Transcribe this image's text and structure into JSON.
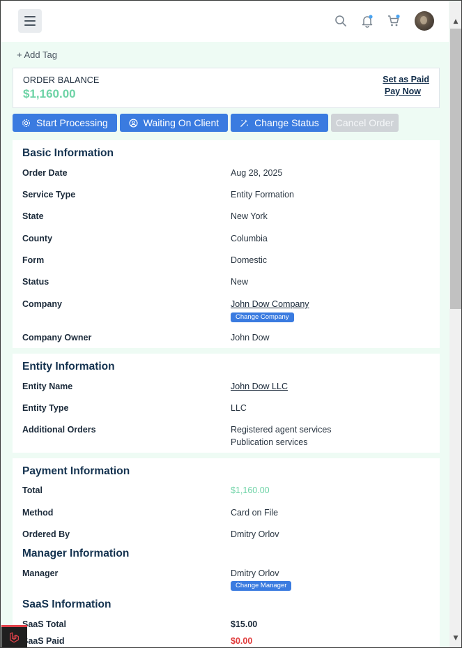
{
  "header": {
    "icons": [
      "menu-icon",
      "search-icon",
      "bell-icon",
      "cart-icon",
      "avatar"
    ],
    "accent": "#3a7be0"
  },
  "tags": {
    "add_label": "+ Add Tag"
  },
  "balance": {
    "label": "ORDER BALANCE",
    "value": "$1,160.00",
    "set_paid": "Set as Paid",
    "pay_now": "Pay Now",
    "value_color": "#6ed3a6"
  },
  "actions": {
    "start": "Start Processing",
    "waiting": "Waiting On Client",
    "change_status": "Change Status",
    "cancel": "Cancel Order"
  },
  "basic": {
    "title": "Basic Information",
    "rows": [
      {
        "label": "Order Date",
        "value": "Aug 28, 2025"
      },
      {
        "label": "Service Type",
        "value": "Entity Formation"
      },
      {
        "label": "State",
        "value": "New York"
      },
      {
        "label": "County",
        "value": "Columbia"
      },
      {
        "label": "Form",
        "value": "Domestic"
      },
      {
        "label": "Status",
        "value": "New"
      },
      {
        "label": "Company",
        "value": "John Dow Company"
      },
      {
        "label": "Company Owner",
        "value": "John Dow"
      }
    ],
    "change_company": "Change Company"
  },
  "entity": {
    "title": "Entity Information",
    "rows": [
      {
        "label": "Entity Name",
        "value": "John Dow LLC"
      },
      {
        "label": "Entity Type",
        "value": "LLC"
      },
      {
        "label": "Additional Orders",
        "values": [
          "Registered agent services",
          "Publication services"
        ]
      }
    ]
  },
  "payment": {
    "title": "Payment Information",
    "rows": [
      {
        "label": "Total",
        "value": "$1,160.00"
      },
      {
        "label": "Method",
        "value": "Card on File"
      },
      {
        "label": "Ordered By",
        "value": "Dmitry Orlov"
      }
    ]
  },
  "manager": {
    "title": "Manager Information",
    "label": "Manager",
    "value": "Dmitry Orlov",
    "change_manager": "Change Manager"
  },
  "saas": {
    "title": "SaaS Information",
    "rows": [
      {
        "label": "SaaS Total",
        "value": "$15.00"
      },
      {
        "label": "SaaS Paid",
        "value": "$0.00"
      }
    ]
  }
}
